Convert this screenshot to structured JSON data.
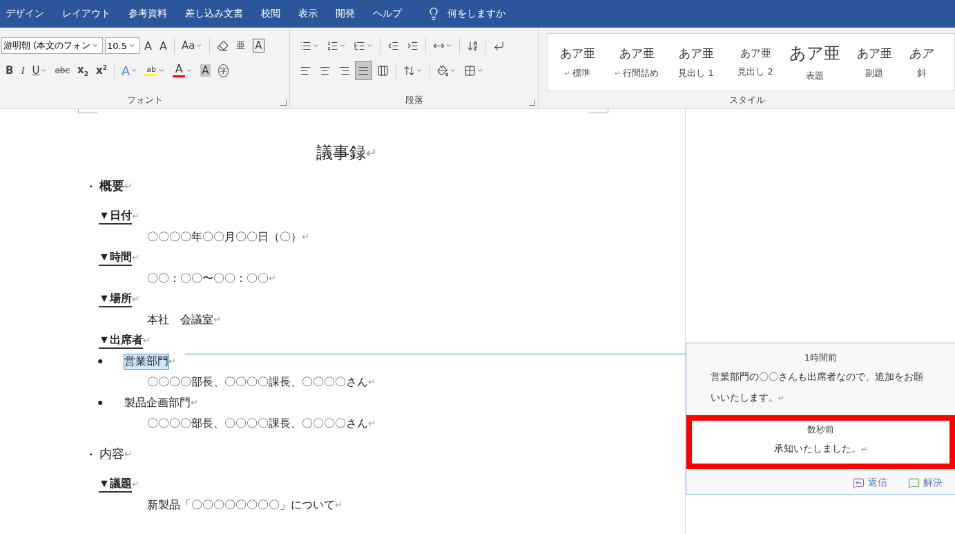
{
  "menu_tabs": [
    {
      "label": "デザイン"
    },
    {
      "label": "レイアウト"
    },
    {
      "label": "参考資料"
    },
    {
      "label": "差し込み文書"
    },
    {
      "label": "校閲"
    },
    {
      "label": "表示"
    },
    {
      "label": "開発"
    },
    {
      "label": "ヘルプ"
    }
  ],
  "tell_me": "何をしますか",
  "font_group": {
    "label": "フォント",
    "row1": [
      {
        "kind": "select",
        "label": "游明朝 (本文のフォン"
      },
      {
        "kind": "size",
        "label": "10.5"
      },
      {
        "kind": "grow",
        "label": "A"
      },
      {
        "kind": "shrink",
        "label": "A"
      },
      {
        "kind": "sep"
      },
      {
        "kind": "case",
        "label": "Aa"
      },
      {
        "kind": "sep"
      },
      {
        "kind": "eraser"
      },
      {
        "kind": "ruby",
        "label": "亜"
      },
      {
        "kind": "boxed",
        "label": "A"
      }
    ],
    "row2": [
      {
        "kind": "bold",
        "label": "B"
      },
      {
        "kind": "italic",
        "label": "I"
      },
      {
        "kind": "underline",
        "label": "U"
      },
      {
        "kind": "strike",
        "label": "abc"
      },
      {
        "kind": "sub",
        "label": "x",
        "small": "2"
      },
      {
        "kind": "sup",
        "label": "x",
        "small": "2"
      },
      {
        "kind": "sep"
      },
      {
        "kind": "effect",
        "label": "A"
      },
      {
        "kind": "highlight",
        "label": "ab",
        "color": "#ffff00"
      },
      {
        "kind": "fontcolor",
        "label": "A",
        "color": "#ff0000"
      },
      {
        "kind": "shade",
        "label": "A"
      },
      {
        "kind": "circled",
        "label": "字"
      }
    ]
  },
  "paragraph_group": {
    "label": "段落",
    "row1": [
      {
        "kind": "bullets"
      },
      {
        "kind": "numbering"
      },
      {
        "kind": "multilevel"
      },
      {
        "kind": "sep"
      },
      {
        "kind": "outdent"
      },
      {
        "kind": "indent"
      },
      {
        "kind": "sep"
      },
      {
        "kind": "asian"
      },
      {
        "kind": "sep"
      },
      {
        "kind": "sort"
      },
      {
        "kind": "sep"
      },
      {
        "kind": "marks"
      }
    ],
    "row2": [
      {
        "kind": "left",
        "selected": false
      },
      {
        "kind": "center",
        "selected": false
      },
      {
        "kind": "right",
        "selected": false
      },
      {
        "kind": "justify",
        "selected": true
      },
      {
        "kind": "distribute",
        "selected": false
      },
      {
        "kind": "sep"
      },
      {
        "kind": "spacing"
      },
      {
        "kind": "sep"
      },
      {
        "kind": "fill"
      },
      {
        "kind": "borders"
      }
    ]
  },
  "styles_group": {
    "label": "スタイル",
    "items": [
      {
        "kind": "normal",
        "sample": "あア亜",
        "mark": "↵",
        "label": "標準"
      },
      {
        "kind": "normal",
        "sample": "あア亜",
        "mark": "↵",
        "label": "行間詰め"
      },
      {
        "kind": "heading",
        "sample": "あア亜",
        "label": "見出し 1"
      },
      {
        "kind": "small",
        "sample": "あア亜",
        "label": "見出し 2"
      },
      {
        "kind": "title",
        "sample": "あア亜",
        "label": "表題"
      },
      {
        "kind": "normal",
        "sample": "あア亜",
        "label": "副題"
      },
      {
        "kind": "italic",
        "sample": "あア",
        "label": "斜"
      }
    ]
  },
  "document": [
    {
      "kind": "title",
      "text": "議事録",
      "mark": "↵"
    },
    {
      "kind": "section",
      "marker": "▪",
      "text": "概要",
      "bold": true,
      "mark": "↵"
    },
    {
      "kind": "heading",
      "text": "▼日付",
      "mark": "↵"
    },
    {
      "kind": "body",
      "text": "〇〇〇〇年〇〇月〇〇日（〇）",
      "mark": "↵"
    },
    {
      "kind": "heading",
      "text": "▼時間",
      "mark": "↵"
    },
    {
      "kind": "body",
      "text": "〇〇：〇〇〜〇〇：〇〇",
      "mark": "↵"
    },
    {
      "kind": "heading",
      "text": "▼場所",
      "mark": "↵"
    },
    {
      "kind": "body",
      "text": "本社　会議室",
      "mark": "↵"
    },
    {
      "kind": "heading",
      "text": "▼出席者",
      "mark": "↵"
    },
    {
      "kind": "bullet",
      "marker": "●",
      "text": "営業部門",
      "selected": true,
      "mark": "↵"
    },
    {
      "kind": "body",
      "text": "〇〇〇〇部長、〇〇〇〇課長、〇〇〇〇さん",
      "mark": "↵"
    },
    {
      "kind": "bullet",
      "marker": "●",
      "text": "製品企画部門",
      "selected": false,
      "mark": "↵"
    },
    {
      "kind": "body",
      "text": "〇〇〇〇部長、〇〇〇〇課長、〇〇〇〇さん",
      "mark": "↵"
    },
    {
      "kind": "section",
      "marker": "▪",
      "text": "内容",
      "bold": false,
      "mark": "↵"
    },
    {
      "kind": "heading",
      "text": "▼議題",
      "mark": "↵"
    },
    {
      "kind": "body",
      "text": "新製品「〇〇〇〇〇〇〇〇」について",
      "mark": "↵"
    }
  ],
  "comment": {
    "entries": [
      {
        "time": "1時間前",
        "text": "営業部門の〇〇さんも出席者なので、追加をお願いいたします。",
        "mark": "↵",
        "highlighted": false
      },
      {
        "time": "数秒前",
        "text": "承知いたしました。",
        "mark": "↵",
        "highlighted": true
      }
    ],
    "actions": [
      {
        "kind": "reply",
        "label": "返信"
      },
      {
        "kind": "resolve",
        "label": "解決"
      }
    ]
  }
}
